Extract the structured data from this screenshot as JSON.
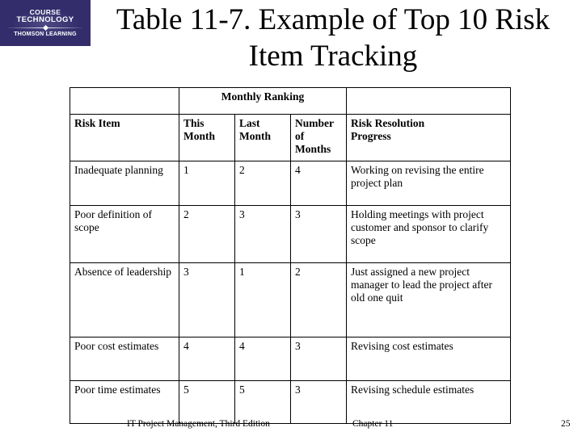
{
  "logo": {
    "line1": "COURSE",
    "line2": "TECHNOLOGY",
    "line3": "THOMSON LEARNING",
    "background_color": "#332d6b",
    "text_color": "#ffffff"
  },
  "slide": {
    "title": "Table 11-7. Example of Top 10 Risk Item Tracking"
  },
  "table": {
    "group_header": {
      "blank_left": "",
      "monthly_ranking": "Monthly Ranking",
      "blank_right": ""
    },
    "columns": [
      "Risk Item",
      "This Month",
      "Last Month",
      "Number of Months",
      "Risk Resolution Progress"
    ],
    "columns_wrapped": [
      [
        "Risk Item"
      ],
      [
        "This",
        "Month"
      ],
      [
        "Last",
        "Month"
      ],
      [
        "Number",
        "of Months"
      ],
      [
        "Risk Resolution",
        "Progress"
      ]
    ],
    "rows": [
      {
        "risk_item": "Inadequate planning",
        "this_month": "1",
        "last_month": "2",
        "number_of_months": "4",
        "progress": "Working on revising the entire project plan"
      },
      {
        "risk_item": "Poor definition of scope",
        "this_month": "2",
        "last_month": "3",
        "number_of_months": "3",
        "progress": "Holding meetings with project customer and sponsor to clarify scope"
      },
      {
        "risk_item": "Absence of leadership",
        "this_month": "3",
        "last_month": "1",
        "number_of_months": "2",
        "progress": "Just assigned a new project manager to lead the project after old one quit"
      },
      {
        "risk_item": "Poor cost estimates",
        "this_month": "4",
        "last_month": "4",
        "number_of_months": "3",
        "progress": "Revising cost estimates"
      },
      {
        "risk_item": "Poor time estimates",
        "this_month": "5",
        "last_month": "5",
        "number_of_months": "3",
        "progress": "Revising schedule estimates"
      }
    ]
  },
  "footer": {
    "book": "IT Project Management, Third Edition",
    "chapter": "Chapter 11",
    "page": "25"
  }
}
